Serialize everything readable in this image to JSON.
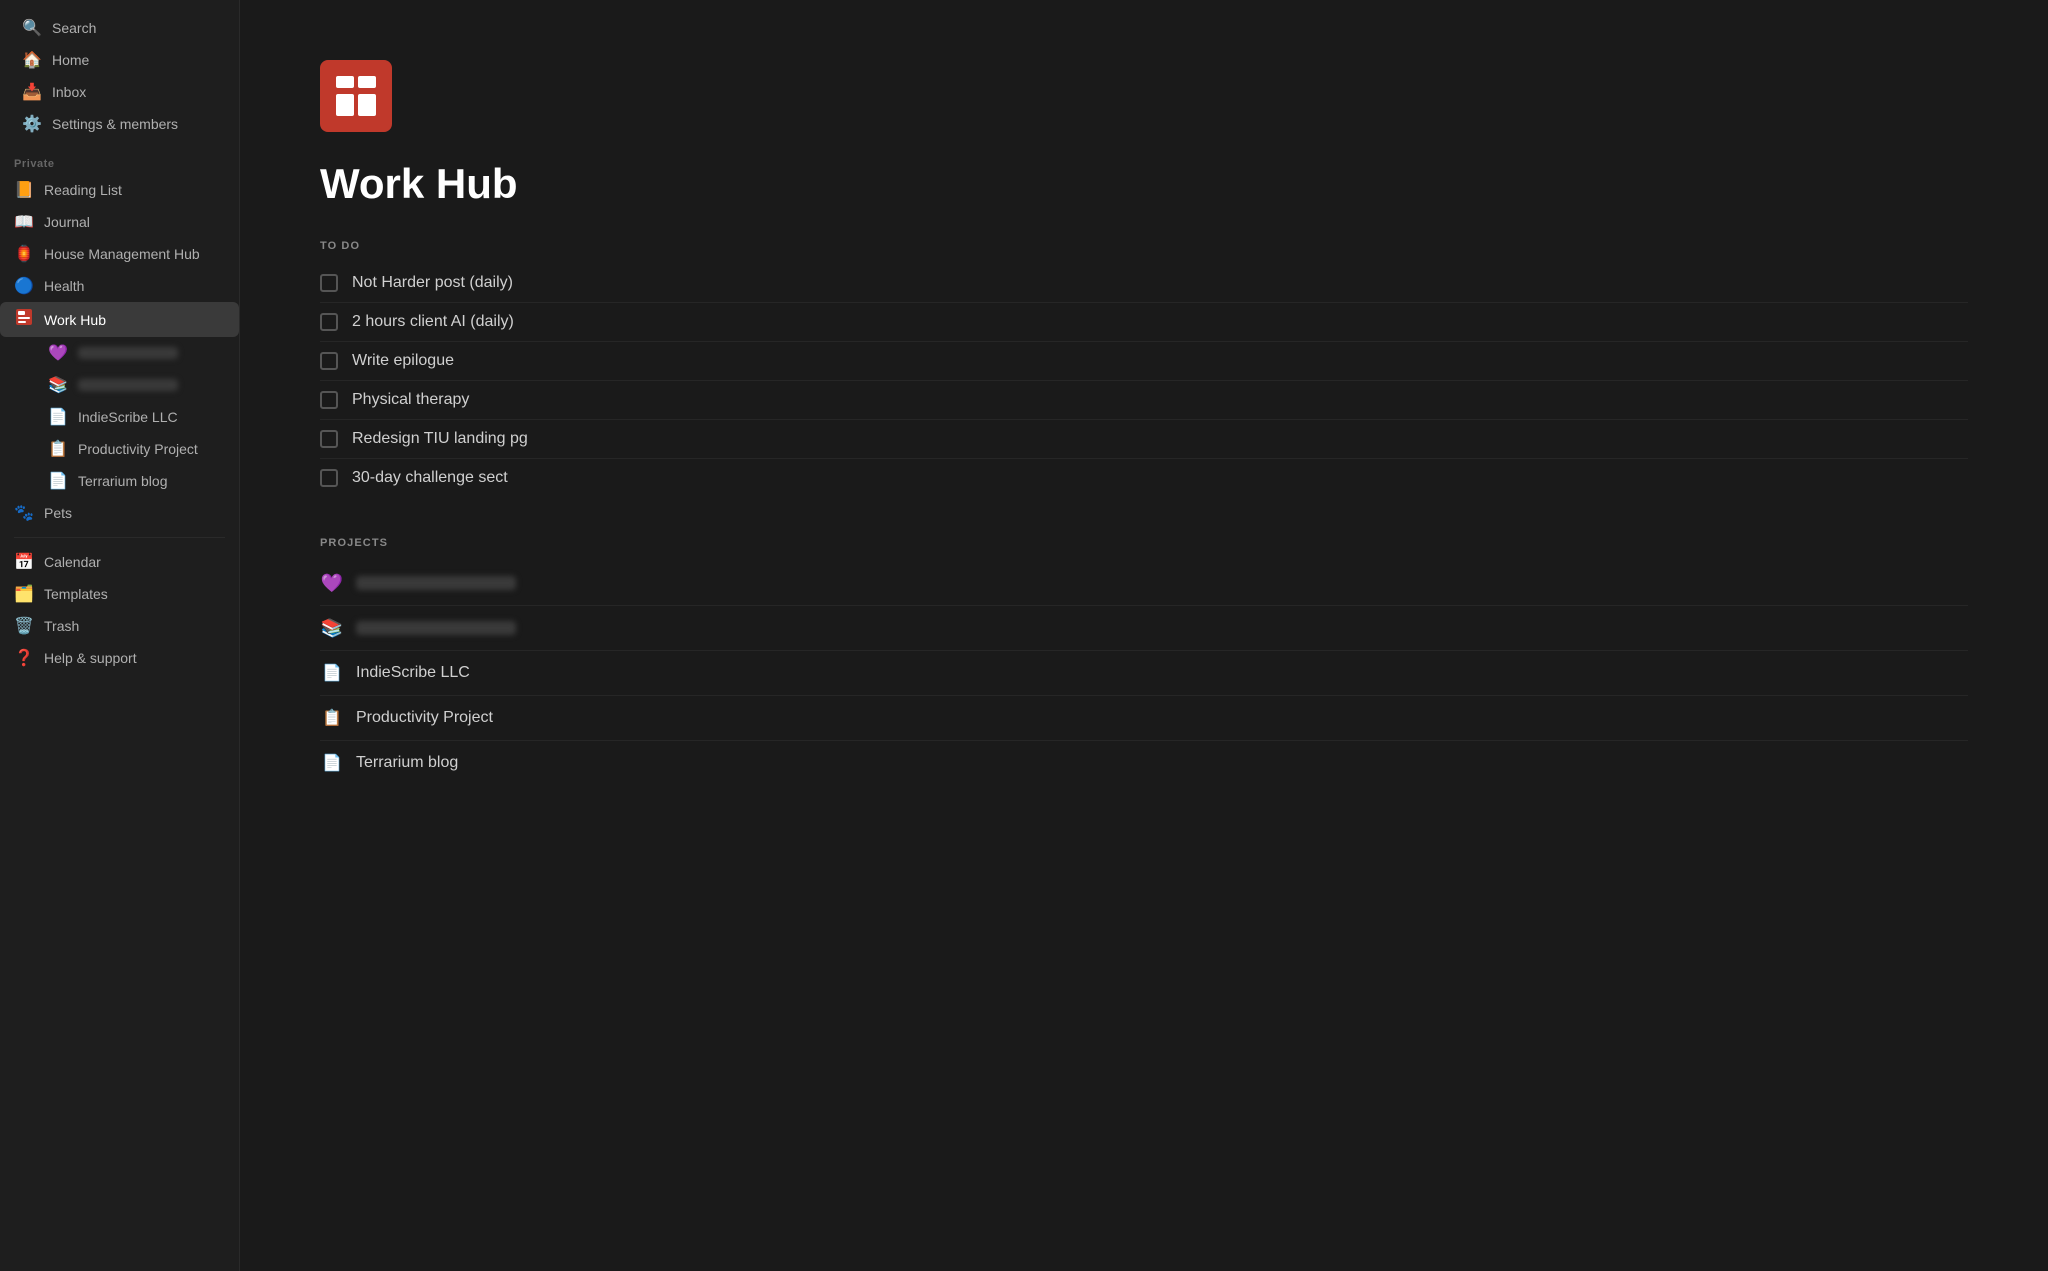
{
  "sidebar": {
    "top_items": [
      {
        "id": "search",
        "label": "Search",
        "icon": "🔍"
      },
      {
        "id": "home",
        "label": "Home",
        "icon": "🏠"
      },
      {
        "id": "inbox",
        "label": "Inbox",
        "icon": "📥"
      },
      {
        "id": "settings",
        "label": "Settings & members",
        "icon": "⚙️"
      }
    ],
    "private_section_label": "Private",
    "private_items": [
      {
        "id": "reading-list",
        "label": "Reading List",
        "icon": "📙",
        "icon_color": "#f39c12"
      },
      {
        "id": "journal",
        "label": "Journal",
        "icon": "📖",
        "icon_color": "#e74c3c"
      },
      {
        "id": "house-management",
        "label": "House Management Hub",
        "icon": "🏮",
        "icon_color": "#e74c3c"
      },
      {
        "id": "health",
        "label": "Health",
        "icon": "🔵",
        "icon_color": "#3498db"
      },
      {
        "id": "work-hub",
        "label": "Work Hub",
        "icon": "📋",
        "icon_color": "#e74c3c",
        "active": true
      }
    ],
    "sub_items": [
      {
        "id": "blurred-1",
        "blurred": true,
        "icon": "💜"
      },
      {
        "id": "blurred-2",
        "blurred": true,
        "icon": "📚"
      },
      {
        "id": "indie-scribe",
        "label": "IndieScribe LLC",
        "icon": "📄"
      },
      {
        "id": "productivity",
        "label": "Productivity Project",
        "icon": "📋"
      },
      {
        "id": "terrarium",
        "label": "Terrarium blog",
        "icon": "📄"
      }
    ],
    "pets": {
      "id": "pets",
      "label": "Pets",
      "icon": "🐾"
    },
    "bottom_items": [
      {
        "id": "calendar",
        "label": "Calendar",
        "icon": "📅"
      },
      {
        "id": "templates",
        "label": "Templates",
        "icon": "🗂️"
      },
      {
        "id": "trash",
        "label": "Trash",
        "icon": "🗑️"
      },
      {
        "id": "help",
        "label": "Help & support",
        "icon": "❓"
      }
    ]
  },
  "main": {
    "page_title": "Work Hub",
    "todo_section_label": "TO DO",
    "todo_items": [
      {
        "id": "todo-1",
        "text": "Not Harder post (daily)",
        "checked": false
      },
      {
        "id": "todo-2",
        "text": "2 hours client AI (daily)",
        "checked": false
      },
      {
        "id": "todo-3",
        "text": "Write epilogue",
        "checked": false
      },
      {
        "id": "todo-4",
        "text": "Physical therapy",
        "checked": false
      },
      {
        "id": "todo-5",
        "text": "Redesign TIU landing pg",
        "checked": false
      },
      {
        "id": "todo-6",
        "text": "30-day challenge sect",
        "checked": false
      }
    ],
    "projects_section_label": "PROJECTS",
    "project_items": [
      {
        "id": "proj-1",
        "blurred": true,
        "icon": "💜",
        "icon_type": "emoji"
      },
      {
        "id": "proj-2",
        "blurred": true,
        "icon": "📚",
        "icon_type": "emoji"
      },
      {
        "id": "proj-3",
        "label": "IndieScribe LLC",
        "icon": "doc",
        "blurred": false
      },
      {
        "id": "proj-4",
        "label": "Productivity Project",
        "icon": "list",
        "blurred": false
      },
      {
        "id": "proj-5",
        "label": "Terrarium blog",
        "icon": "doc",
        "blurred": false
      }
    ]
  }
}
